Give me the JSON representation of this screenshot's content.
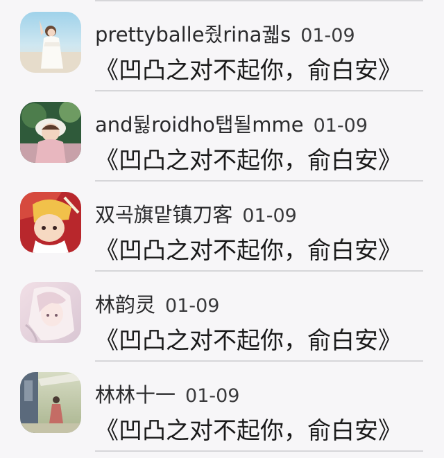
{
  "comments": [
    {
      "username": "prettyballe줬rina궯s",
      "date": "01-09",
      "title": "《凹凸之对不起你，俞白安》",
      "avatar_icon": "avatar-girl-beach-photo"
    },
    {
      "username": "and뒳roidho탭될mme",
      "date": "01-09",
      "title": "《凹凸之对不起你，俞白安》",
      "avatar_icon": "avatar-child-photo"
    },
    {
      "username": "双곡旗맡镇刀客",
      "date": "01-09",
      "title": "《凹凸之对不起你，俞白安》",
      "avatar_icon": "avatar-anime-character"
    },
    {
      "username": "林韵灵",
      "date": "01-09",
      "title": "《凹凸之对不起你，俞白安》",
      "avatar_icon": "avatar-anime-girl-pink"
    },
    {
      "username": "林林十一",
      "date": "01-09",
      "title": "《凹凸之对不起你，俞白安》",
      "avatar_icon": "avatar-scenery-photo"
    }
  ]
}
